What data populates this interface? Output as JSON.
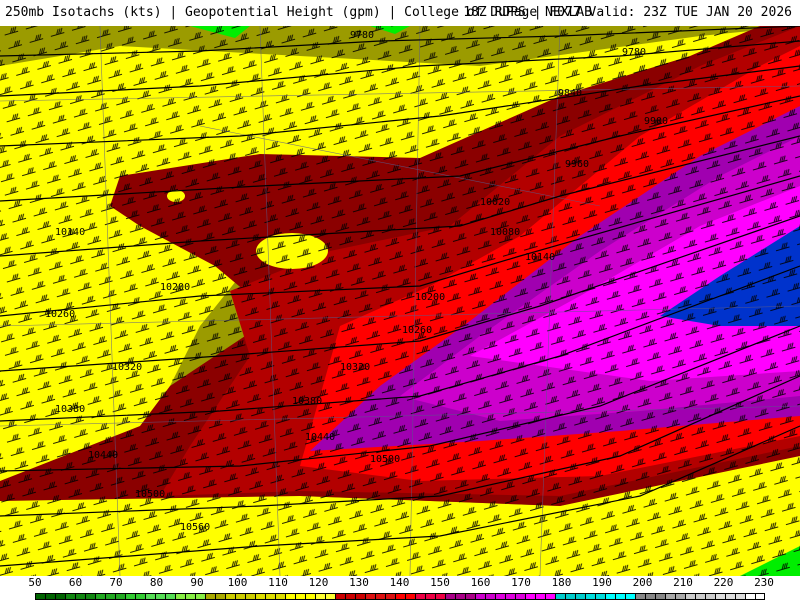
{
  "header": {
    "left": "250mb Isotachs (kts) | Geopotential Height (gpm) | College of DuPage NEXLAB",
    "right": "18Z RDPS | F077 Valid: 23Z TUE JAN 20 2026"
  },
  "contour_labels": [
    "9780",
    "9780",
    "9840",
    "9900",
    "9960",
    "10020",
    "10080",
    "10140",
    "10140",
    "10200",
    "10200",
    "10260",
    "10260",
    "10320",
    "10320",
    "10380",
    "10380",
    "10440",
    "10440",
    "10500",
    "10500",
    "10560"
  ],
  "legend": {
    "ticks": [
      "50",
      "60",
      "70",
      "80",
      "90",
      "100",
      "110",
      "120",
      "130",
      "140",
      "150",
      "160",
      "170",
      "180",
      "190",
      "200",
      "210",
      "220",
      "230"
    ],
    "colors": [
      "#006400",
      "#118811",
      "#22aa22",
      "#33cc33",
      "#55dd55",
      "#88ee44",
      "#aaaa00",
      "#cccc00",
      "#dddd00",
      "#ffff00",
      "#ffff33",
      "#cc0000",
      "#dd1111",
      "#ff0000",
      "#ee0044",
      "#aa0088",
      "#cc00cc",
      "#dd00dd",
      "#ff00ff",
      "#00cccc",
      "#00dddd",
      "#00ffff",
      "#888888",
      "#aaaaaa",
      "#cccccc",
      "#dddddd",
      "#ffffff"
    ]
  },
  "colors": {
    "band_80_90": "#9b9b00",
    "band_90_110": "#ffff00",
    "band_110_120": "#8b0000",
    "band_120_130": "#b30000",
    "band_130_140": "#ff0000",
    "band_140_150": "#a000b0",
    "band_150_160": "#cc00cc",
    "band_160_170": "#ff00ff",
    "band_170_180": "#0033cc",
    "green": "#00ee00"
  }
}
